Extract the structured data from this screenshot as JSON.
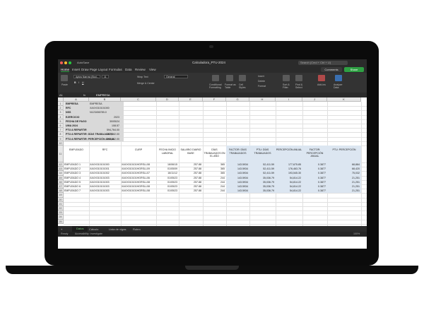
{
  "window": {
    "autosave": "AutoSave",
    "title": "Calculadora_PTU-2024",
    "search_placeholder": "Search (Cmd + Ctrl + U)"
  },
  "menu": [
    "Home",
    "Insert",
    "Draw",
    "Page Layout",
    "Formulas",
    "Data",
    "Review",
    "View"
  ],
  "menu_active": "Home",
  "buttons": {
    "comments": "Comments",
    "share": "Share"
  },
  "ribbon": {
    "paste": "Paste",
    "font_name": "Aptos Narrow (Bod...",
    "font_size": "11",
    "wrap_text": "Wrap Text",
    "merge_center": "Merge & Center",
    "number_format": "General",
    "conditional_formatting": "Conditional Formatting",
    "format_as_table": "Format as Table",
    "cell_styles": "Cell Styles",
    "insert": "Insert",
    "delete": "Delete",
    "format": "Format",
    "sort_filter": "Sort & Filter",
    "find_select": "Find & Select",
    "addins": "Add-ins",
    "analyze_data": "Analyze Data"
  },
  "formula_bar": {
    "cell_ref": "A1",
    "fx": "fx",
    "value": "EMPRESA"
  },
  "columns": [
    "A",
    "B",
    "C",
    "D",
    "E",
    "F",
    "G",
    "H",
    "I",
    "J",
    "K"
  ],
  "info_block": [
    {
      "label": "EMPRESA",
      "value": "EMPRESA"
    },
    {
      "label": "RFC",
      "value": "XAXX010101000"
    },
    {
      "label": "NSS",
      "value": "N123456789-0"
    },
    {
      "label": "EJERCICIO",
      "value": "2023"
    },
    {
      "label": "FECHA DE PAGO",
      "value": "30/05/24"
    },
    {
      "label": "UMA 2024",
      "value": "108.57"
    },
    {
      "label": "PTU A REPARTIR",
      "value": "594,764.00"
    },
    {
      "label": "PTU A REPARTIR: DÍAS TRABAJADOS",
      "value": "297,382.00"
    },
    {
      "label": "PTU A REPARTIR: PERCEPCIÓN ANUAL",
      "value": "297,382.00"
    }
  ],
  "table_headers": [
    "EMPLEADO",
    "RFC",
    "CURP",
    "FECHA INICIO LABORAL",
    "SALARIO DIARIO BASE",
    "DÍAS TRABAJADOS EN EL AÑO",
    "FACTOR: DÍAS TRABAJADOS",
    "PTU: DÍAS TRABAJADOS",
    "PERCEPCIÓN ANUAL",
    "FACTOR: PERCEPCIÓN ANUAL",
    "PTU: PERCEPCIÓN"
  ],
  "employees": [
    [
      "EMPLEADO 1",
      "XAXX010101000",
      "XAXX010101HGRSLL08",
      "16/06/15",
      "257.88",
      "365",
      "143.5934",
      "52,411.59",
      "177,675.85",
      "0.3877",
      "68,884"
    ],
    [
      "EMPLEADO 2",
      "XAXX010101001",
      "XAXX010101HGRSLL09",
      "01/05/09",
      "257.88",
      "365",
      "143.5934",
      "52,411.59",
      "176,463.76",
      "0.3877",
      "68,420"
    ],
    [
      "EMPLEADO 3",
      "XAXX010101002",
      "XAXX010101HGRSLL07",
      "16/11/12",
      "257.88",
      "365",
      "143.5934",
      "52,411.59",
      "193,545.30",
      "0.3877",
      "75,032"
    ],
    [
      "EMPLEADO 4",
      "XAXX010101003",
      "XAXX010101HGRSLL06",
      "01/05/23",
      "257.88",
      "244",
      "143.5934",
      "35,036.79",
      "54,814.22",
      "0.3877",
      "21,251"
    ],
    [
      "EMPLEADO 5",
      "XAXX010101003",
      "XAXX010101HGRSLL08",
      "01/05/23",
      "257.88",
      "244",
      "143.5934",
      "35,036.79",
      "54,814.22",
      "0.3877",
      "21,251"
    ],
    [
      "EMPLEADO 6",
      "XAXX010101003",
      "XAXX010101HGRSLL08",
      "01/05/23",
      "257.88",
      "244",
      "143.5934",
      "35,036.79",
      "54,814.22",
      "0.3877",
      "21,251"
    ],
    [
      "EMPLEADO 7",
      "XAXX010101003",
      "XAXX010101HGRSLL08",
      "01/05/23",
      "257.88",
      "244",
      "143.5934",
      "35,036.79",
      "54,814.22",
      "0.3877",
      "21,251"
    ]
  ],
  "sheet_tabs": [
    "Datos",
    "Cálculo",
    "Lista de vigas",
    "Rubro"
  ],
  "sheet_active": "Datos",
  "status": {
    "ready": "Ready",
    "accessibility": "Accessibility: Investigate",
    "zoom": "100%"
  },
  "colors": {
    "accent_green": "#2ea043",
    "header_gray": "#d9d9d9",
    "highlight_blue": "#dce6f1",
    "chrome_dark": "#2b2b2b"
  }
}
